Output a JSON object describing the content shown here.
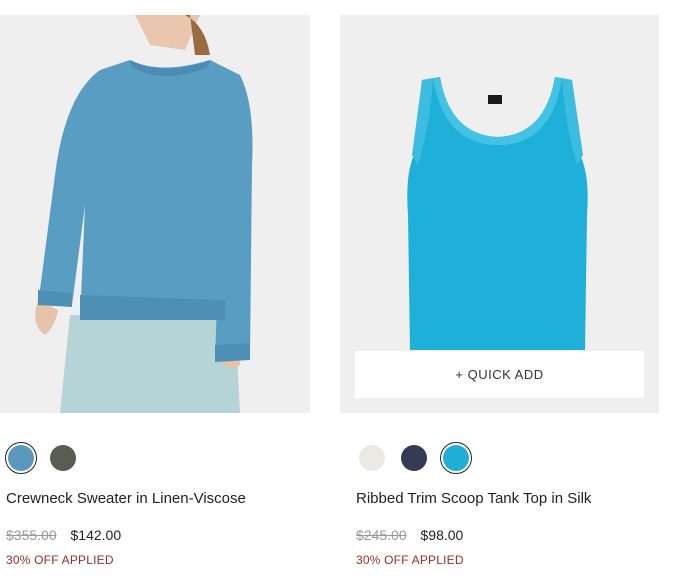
{
  "products": [
    {
      "name": "Crewneck Sweater in Linen-Viscose",
      "original_price": "$355.00",
      "sale_price": "$142.00",
      "promo": "30% OFF APPLIED",
      "image_icon": "sweater-image",
      "swatches": [
        {
          "color": "#5b98bd",
          "selected": true
        },
        {
          "color": "#575d52",
          "selected": false
        }
      ]
    },
    {
      "name": "Ribbed Trim Scoop Tank Top in Silk",
      "original_price": "$245.00",
      "sale_price": "$98.00",
      "promo": "30% OFF APPLIED",
      "image_icon": "tank-top-image",
      "quick_add_label": "+ QUICK ADD",
      "swatches": [
        {
          "color": "#ebe9e4",
          "selected": false
        },
        {
          "color": "#363b55",
          "selected": false
        },
        {
          "color": "#1eaed6",
          "selected": true
        }
      ]
    }
  ]
}
